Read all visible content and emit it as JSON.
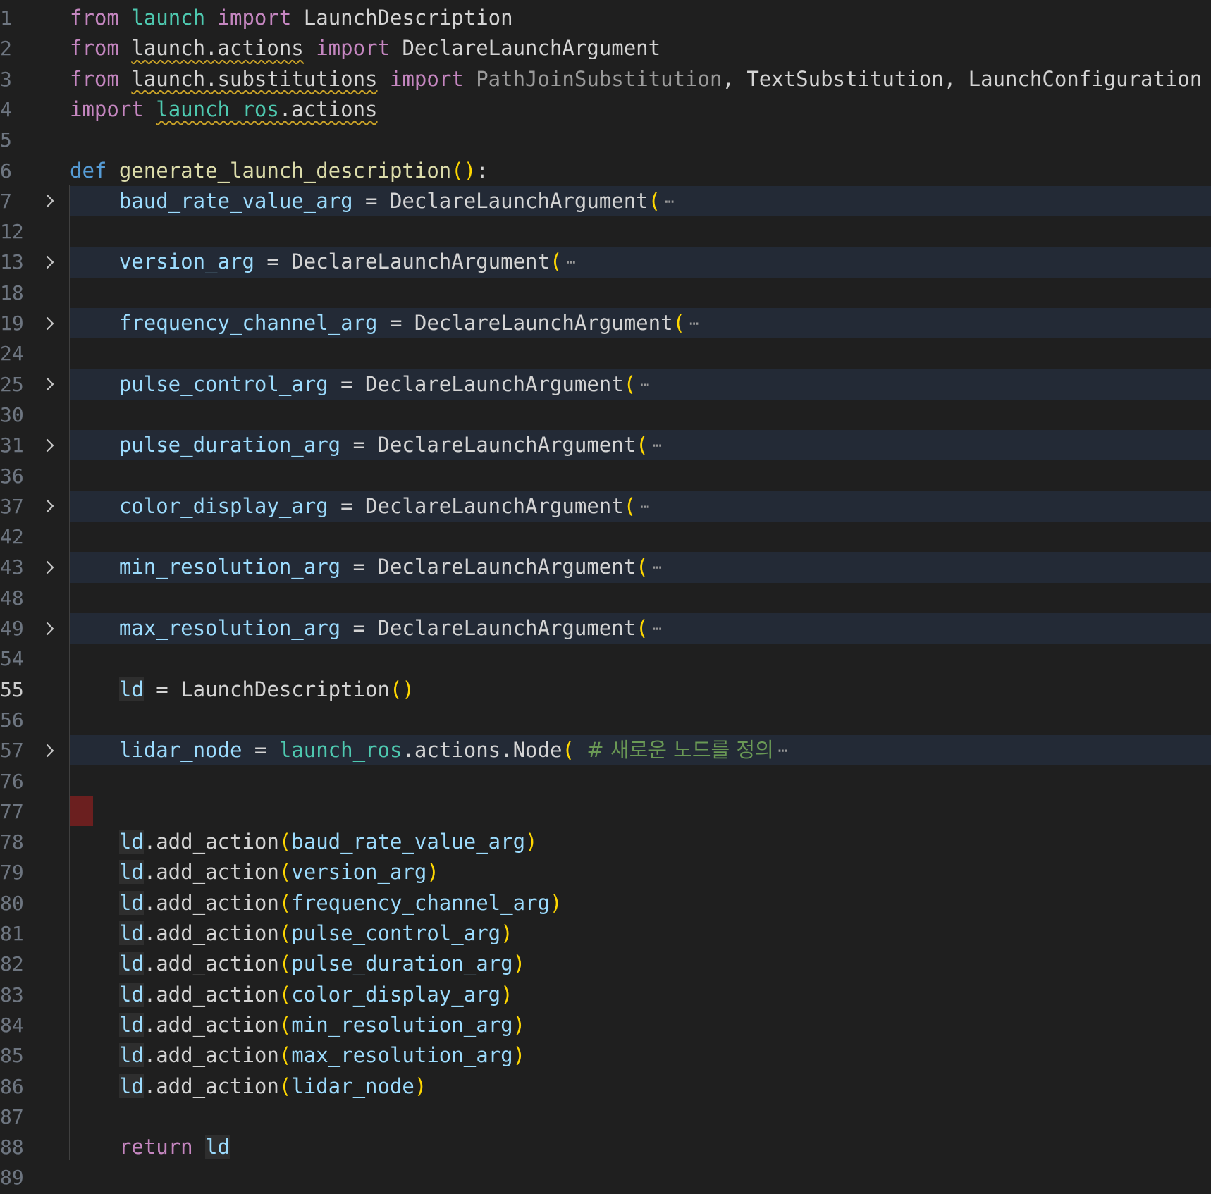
{
  "editor": {
    "language": "python",
    "current_line": "55",
    "lines": [
      {
        "no": "1",
        "tokens": [
          [
            "from",
            "k"
          ],
          [
            " ",
            "t"
          ],
          [
            "launch",
            "m"
          ],
          [
            " ",
            "t"
          ],
          [
            "import",
            "k"
          ],
          [
            " ",
            "t"
          ],
          [
            "LaunchDescription",
            "t"
          ]
        ]
      },
      {
        "no": "2",
        "tokens": [
          [
            "from",
            "k"
          ],
          [
            " ",
            "t"
          ],
          [
            "launch.actions",
            "t sq"
          ],
          [
            " ",
            "t"
          ],
          [
            "import",
            "k"
          ],
          [
            " ",
            "t"
          ],
          [
            "DeclareLaunchArgument",
            "t"
          ]
        ]
      },
      {
        "no": "3",
        "tokens": [
          [
            "from",
            "k"
          ],
          [
            " ",
            "t"
          ],
          [
            "launch.substitutions",
            "t sq"
          ],
          [
            " ",
            "t"
          ],
          [
            "import",
            "k"
          ],
          [
            " ",
            "t"
          ],
          [
            "PathJoinSubstitution",
            "d"
          ],
          [
            ", ",
            "t"
          ],
          [
            "TextSubstitution",
            "t"
          ],
          [
            ", ",
            "t"
          ],
          [
            "LaunchConfiguration",
            "t"
          ]
        ]
      },
      {
        "no": "4",
        "tokens": [
          [
            "import",
            "k"
          ],
          [
            " ",
            "t"
          ],
          [
            "launch_ros",
            "m sq"
          ],
          [
            ".actions",
            "t sq"
          ]
        ]
      },
      {
        "no": "5",
        "tokens": []
      },
      {
        "no": "6",
        "tokens": [
          [
            "def",
            "kd"
          ],
          [
            " ",
            "t"
          ],
          [
            "generate_launch_description",
            "f"
          ],
          [
            "()",
            "p"
          ],
          [
            ":",
            "t"
          ]
        ]
      },
      {
        "no": "7",
        "folded": true,
        "tokens": [
          [
            "    ",
            "t"
          ],
          [
            "baud_rate_value_arg",
            "v"
          ],
          [
            " = ",
            "t"
          ],
          [
            "DeclareLaunchArgument",
            "t"
          ],
          [
            "(",
            "p"
          ]
        ]
      },
      {
        "no": "12",
        "tokens": []
      },
      {
        "no": "13",
        "folded": true,
        "tokens": [
          [
            "    ",
            "t"
          ],
          [
            "version_arg",
            "v"
          ],
          [
            " = ",
            "t"
          ],
          [
            "DeclareLaunchArgument",
            "t"
          ],
          [
            "(",
            "p"
          ]
        ]
      },
      {
        "no": "18",
        "tokens": []
      },
      {
        "no": "19",
        "folded": true,
        "tokens": [
          [
            "    ",
            "t"
          ],
          [
            "frequency_channel_arg",
            "v"
          ],
          [
            " = ",
            "t"
          ],
          [
            "DeclareLaunchArgument",
            "t"
          ],
          [
            "(",
            "p"
          ]
        ]
      },
      {
        "no": "24",
        "tokens": []
      },
      {
        "no": "25",
        "folded": true,
        "tokens": [
          [
            "    ",
            "t"
          ],
          [
            "pulse_control_arg",
            "v"
          ],
          [
            " = ",
            "t"
          ],
          [
            "DeclareLaunchArgument",
            "t"
          ],
          [
            "(",
            "p"
          ]
        ]
      },
      {
        "no": "30",
        "tokens": []
      },
      {
        "no": "31",
        "folded": true,
        "tokens": [
          [
            "    ",
            "t"
          ],
          [
            "pulse_duration_arg",
            "v"
          ],
          [
            " = ",
            "t"
          ],
          [
            "DeclareLaunchArgument",
            "t"
          ],
          [
            "(",
            "p"
          ]
        ]
      },
      {
        "no": "36",
        "tokens": []
      },
      {
        "no": "37",
        "folded": true,
        "tokens": [
          [
            "    ",
            "t"
          ],
          [
            "color_display_arg",
            "v"
          ],
          [
            " = ",
            "t"
          ],
          [
            "DeclareLaunchArgument",
            "t"
          ],
          [
            "(",
            "p"
          ]
        ]
      },
      {
        "no": "42",
        "tokens": []
      },
      {
        "no": "43",
        "folded": true,
        "tokens": [
          [
            "    ",
            "t"
          ],
          [
            "min_resolution_arg",
            "v"
          ],
          [
            " = ",
            "t"
          ],
          [
            "DeclareLaunchArgument",
            "t"
          ],
          [
            "(",
            "p"
          ]
        ]
      },
      {
        "no": "48",
        "tokens": []
      },
      {
        "no": "49",
        "folded": true,
        "tokens": [
          [
            "    ",
            "t"
          ],
          [
            "max_resolution_arg",
            "v"
          ],
          [
            " = ",
            "t"
          ],
          [
            "DeclareLaunchArgument",
            "t"
          ],
          [
            "(",
            "p"
          ]
        ]
      },
      {
        "no": "54",
        "tokens": []
      },
      {
        "no": "55",
        "tokens": [
          [
            "    ",
            "t"
          ],
          [
            "ld",
            "v hlv"
          ],
          [
            " = ",
            "t"
          ],
          [
            "LaunchDescription",
            "t"
          ],
          [
            "()",
            "p"
          ]
        ]
      },
      {
        "no": "56",
        "tokens": []
      },
      {
        "no": "57",
        "folded": true,
        "tokens": [
          [
            "    ",
            "t"
          ],
          [
            "lidar_node",
            "v"
          ],
          [
            " = ",
            "t"
          ],
          [
            "launch_ros",
            "m"
          ],
          [
            ".actions.Node",
            "t"
          ],
          [
            "(",
            "p"
          ],
          [
            " ",
            "t"
          ],
          [
            "# 새로운 노드를 정의",
            "c"
          ]
        ]
      },
      {
        "no": "76",
        "tokens": []
      },
      {
        "no": "77",
        "tokens": []
      },
      {
        "no": "78",
        "tokens": [
          [
            "    ",
            "t"
          ],
          [
            "ld",
            "v hlv"
          ],
          [
            ".add_action",
            "t"
          ],
          [
            "(",
            "p"
          ],
          [
            "baud_rate_value_arg",
            "v"
          ],
          [
            ")",
            "p"
          ]
        ]
      },
      {
        "no": "79",
        "tokens": [
          [
            "    ",
            "t"
          ],
          [
            "ld",
            "v hlv"
          ],
          [
            ".add_action",
            "t"
          ],
          [
            "(",
            "p"
          ],
          [
            "version_arg",
            "v"
          ],
          [
            ")",
            "p"
          ]
        ]
      },
      {
        "no": "80",
        "tokens": [
          [
            "    ",
            "t"
          ],
          [
            "ld",
            "v hlv"
          ],
          [
            ".add_action",
            "t"
          ],
          [
            "(",
            "p"
          ],
          [
            "frequency_channel_arg",
            "v"
          ],
          [
            ")",
            "p"
          ]
        ]
      },
      {
        "no": "81",
        "tokens": [
          [
            "    ",
            "t"
          ],
          [
            "ld",
            "v hlv"
          ],
          [
            ".add_action",
            "t"
          ],
          [
            "(",
            "p"
          ],
          [
            "pulse_control_arg",
            "v"
          ],
          [
            ")",
            "p"
          ]
        ]
      },
      {
        "no": "82",
        "tokens": [
          [
            "    ",
            "t"
          ],
          [
            "ld",
            "v hlv"
          ],
          [
            ".add_action",
            "t"
          ],
          [
            "(",
            "p"
          ],
          [
            "pulse_duration_arg",
            "v"
          ],
          [
            ")",
            "p"
          ]
        ]
      },
      {
        "no": "83",
        "tokens": [
          [
            "    ",
            "t"
          ],
          [
            "ld",
            "v hlv"
          ],
          [
            ".add_action",
            "t"
          ],
          [
            "(",
            "p"
          ],
          [
            "color_display_arg",
            "v"
          ],
          [
            ")",
            "p"
          ]
        ]
      },
      {
        "no": "84",
        "tokens": [
          [
            "    ",
            "t"
          ],
          [
            "ld",
            "v hlv"
          ],
          [
            ".add_action",
            "t"
          ],
          [
            "(",
            "p"
          ],
          [
            "min_resolution_arg",
            "v"
          ],
          [
            ")",
            "p"
          ]
        ]
      },
      {
        "no": "85",
        "tokens": [
          [
            "    ",
            "t"
          ],
          [
            "ld",
            "v hlv"
          ],
          [
            ".add_action",
            "t"
          ],
          [
            "(",
            "p"
          ],
          [
            "max_resolution_arg",
            "v"
          ],
          [
            ")",
            "p"
          ]
        ]
      },
      {
        "no": "86",
        "tokens": [
          [
            "    ",
            "t"
          ],
          [
            "ld",
            "v hlv"
          ],
          [
            ".add_action",
            "t"
          ],
          [
            "(",
            "p"
          ],
          [
            "lidar_node",
            "v"
          ],
          [
            ")",
            "p"
          ]
        ]
      },
      {
        "no": "87",
        "tokens": []
      },
      {
        "no": "88",
        "tokens": [
          [
            "    ",
            "t"
          ],
          [
            "return",
            "k"
          ],
          [
            " ",
            "t"
          ],
          [
            "ld",
            "v hlv"
          ]
        ]
      },
      {
        "no": "89",
        "tokens": []
      }
    ]
  }
}
